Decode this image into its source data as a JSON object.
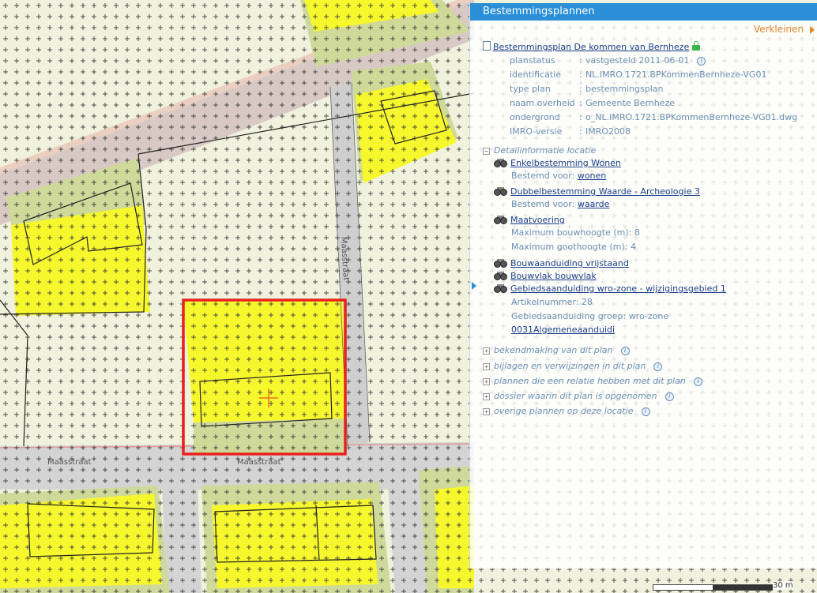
{
  "panel": {
    "title": "Bestemmingsplannen",
    "collapse_label": "Verkleinen"
  },
  "plan": {
    "title": "Bestemmingsplan De kommen van Bernheze",
    "fields": [
      {
        "key": "planstatus",
        "value": "vastgesteld 2011-06-01",
        "info": true
      },
      {
        "key": "identificatie",
        "value": "NL.IMRO.1721.BPKommenBernheze-VG01",
        "info": false
      },
      {
        "key": "type plan",
        "value": "bestemmingsplan",
        "info": false
      },
      {
        "key": "naam overheid",
        "value": "Gemeente Bernheze",
        "info": false
      },
      {
        "key": "ondergrond",
        "value": "o_NL.IMRO.1721.BPKommenBernheze-VG01.dwg",
        "info": false
      },
      {
        "key": "IMRO-versie",
        "value": "IMRO2008",
        "info": false
      }
    ]
  },
  "detail": {
    "heading": "Detailinformatie locatie",
    "items": [
      {
        "label": "Enkelbestemming Wonen",
        "sub": [
          {
            "text": "Bestemd voor: ",
            "link": "wonen"
          }
        ]
      },
      {
        "label": "Dubbelbestemming Waarde - Archeologie 3",
        "sub": [
          {
            "text": "Bestemd voor: ",
            "link": "waarde"
          }
        ]
      },
      {
        "label": "Maatvoering",
        "sub": [
          {
            "text": "Maximum bouwhoogte (m): 8",
            "link": ""
          },
          {
            "text": "Maximum goothoogte (m): 4",
            "link": ""
          }
        ]
      },
      {
        "label": "Bouwaanduiding vrijstaand",
        "sub": []
      },
      {
        "label": "Bouwvlak bouwvlak",
        "sub": []
      },
      {
        "label": "Gebiedsaanduiding wro-zone - wijzigingsgebied 1",
        "sub": [
          {
            "text": "Artikelnummer: 28",
            "link": ""
          },
          {
            "text": "Gebiedsaanduiding groep: wro-zone",
            "link": ""
          },
          {
            "text": "",
            "link": "0031Algemeneaanduidi"
          }
        ]
      }
    ]
  },
  "collapsed_sections": [
    "bekendmaking van dit plan",
    "bijlagen en verwijzingen in dit plan",
    "plannen die een relatie hebben met dit plan",
    "dossier waarin dit plan is opgenomen",
    "overige plannen op deze locatie"
  ],
  "map": {
    "street_labels": [
      "Maasstraat",
      "Maasstraat",
      "Maasstraat"
    ],
    "scale_label": "30 m",
    "colors": {
      "wonen": "#f7f72e",
      "tuin": "#cfd99a",
      "verkeer": "#d2d2d2",
      "selection": "#e8201e"
    }
  }
}
